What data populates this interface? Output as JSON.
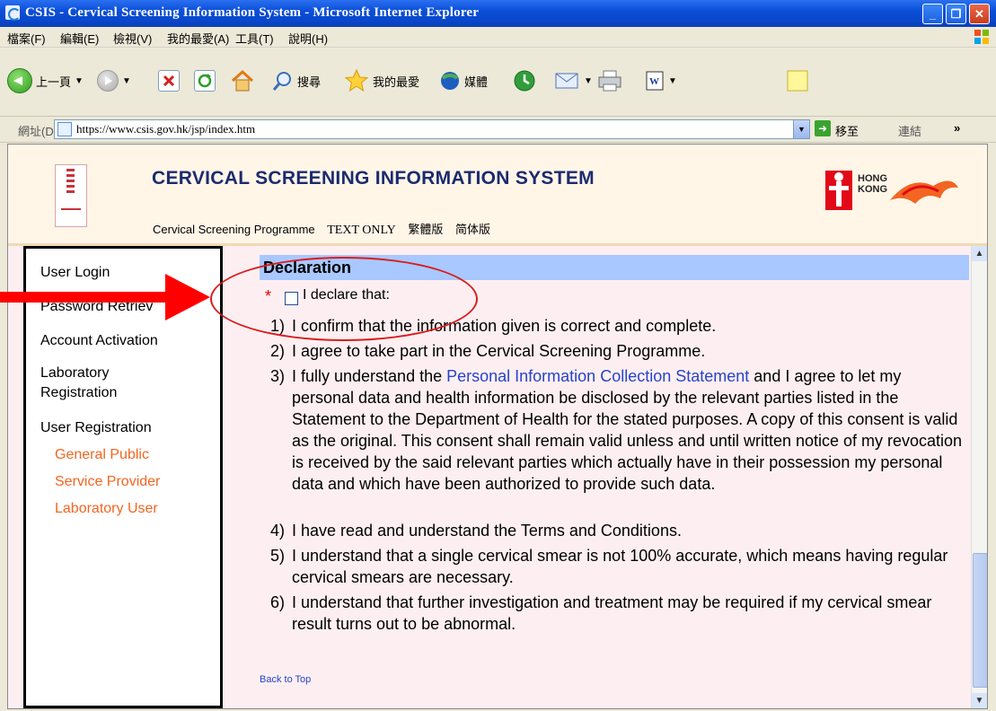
{
  "window": {
    "title": "CSIS - Cervical Screening Information System - Microsoft Internet Explorer",
    "buttons": {
      "minimize": "_",
      "maximize": "❐",
      "close": "✕"
    }
  },
  "menu": [
    "檔案(F)",
    "編輯(E)",
    "檢視(V)",
    "我的最愛(A)",
    "工具(T)",
    "說明(H)"
  ],
  "toolbar": {
    "back_label": "上一頁",
    "search_label": "搜尋",
    "favorites_label": "我的最愛",
    "media_label": "媒體"
  },
  "address": {
    "label": "網址(D)",
    "url": "https://www.csis.gov.hk/jsp/index.htm",
    "go_label": "移至",
    "links_label": "連結",
    "more": "»"
  },
  "header": {
    "system_title": "CERVICAL SCREENING INFORMATION SYSTEM",
    "nav": [
      "Cervical Screening Programme",
      "TEXT ONLY",
      "繁體版",
      "简体版"
    ],
    "hk_logo_text": [
      "HONG",
      "KONG"
    ]
  },
  "sidebar": {
    "items": [
      "User Login",
      "Password Retriev",
      "Account Activation",
      "Laboratory",
      "Registration",
      "User Registration"
    ],
    "sub_items": [
      "General Public",
      "Service Provider",
      "Laboratory User"
    ]
  },
  "declaration": {
    "title": "Declaration",
    "required_mark": "*",
    "checkbox_label": "I declare that:",
    "checked": false,
    "items": [
      {
        "num": "1)",
        "text": "I confirm that the information given is correct and complete."
      },
      {
        "num": "2)",
        "text": "I agree to take part in the Cervical Screening Programme."
      },
      {
        "num": "3)",
        "pre": "I fully understand the ",
        "link": "Personal Information Collection Statement",
        "post": " and I agree to let my personal data and health information be disclosed by the relevant parties listed in the Statement to the Department of Health for the stated purposes. A copy of this consent is valid as the original. This consent shall remain valid unless and until written notice of my revocation is received by the said relevant parties which actually have in their possession my personal data and which have been authorized to provide such data."
      },
      {
        "num": "4)",
        "text": "I have read and understand the Terms and Conditions."
      },
      {
        "num": "5)",
        "text": "I understand that a single cervical smear is not 100% accurate, which means having regular cervical smears are necessary."
      },
      {
        "num": "6)",
        "text": "I understand that further investigation and treatment may be required if my cervical smear result turns out to be abnormal."
      }
    ],
    "back_to_top": "Back to Top"
  },
  "colors": {
    "accent_link": "#2743c8",
    "sidebar_sub": "#f26522",
    "annotation": "#ff0000",
    "header_bar": "#a8c8ff"
  }
}
